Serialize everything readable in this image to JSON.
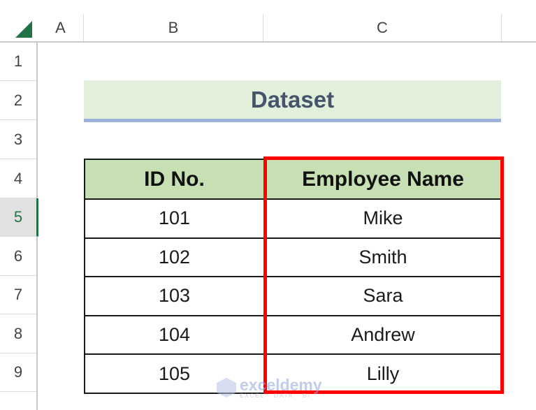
{
  "sheet": {
    "columns": [
      "A",
      "B",
      "C"
    ],
    "rows": [
      "1",
      "2",
      "3",
      "4",
      "5",
      "6",
      "7",
      "8",
      "9"
    ],
    "selected_row": "5"
  },
  "title": "Dataset",
  "table": {
    "headers": [
      "ID No.",
      "Employee Name"
    ],
    "rows": [
      [
        "101",
        "Mike"
      ],
      [
        "102",
        "Smith"
      ],
      [
        "103",
        "Sara"
      ],
      [
        "104",
        "Andrew"
      ],
      [
        "105",
        "Lilly"
      ]
    ]
  },
  "highlight": {
    "column": "Employee Name",
    "color": "#FF0000"
  },
  "watermark": {
    "name": "exceldemy",
    "tagline": "EXCEL · DATA · BI"
  },
  "colors": {
    "header_fill": "#C6E0B4",
    "title_fill": "#E2EFDA",
    "title_text": "#44546A",
    "title_underline": "#9DB3DE",
    "excel_green": "#217346"
  }
}
